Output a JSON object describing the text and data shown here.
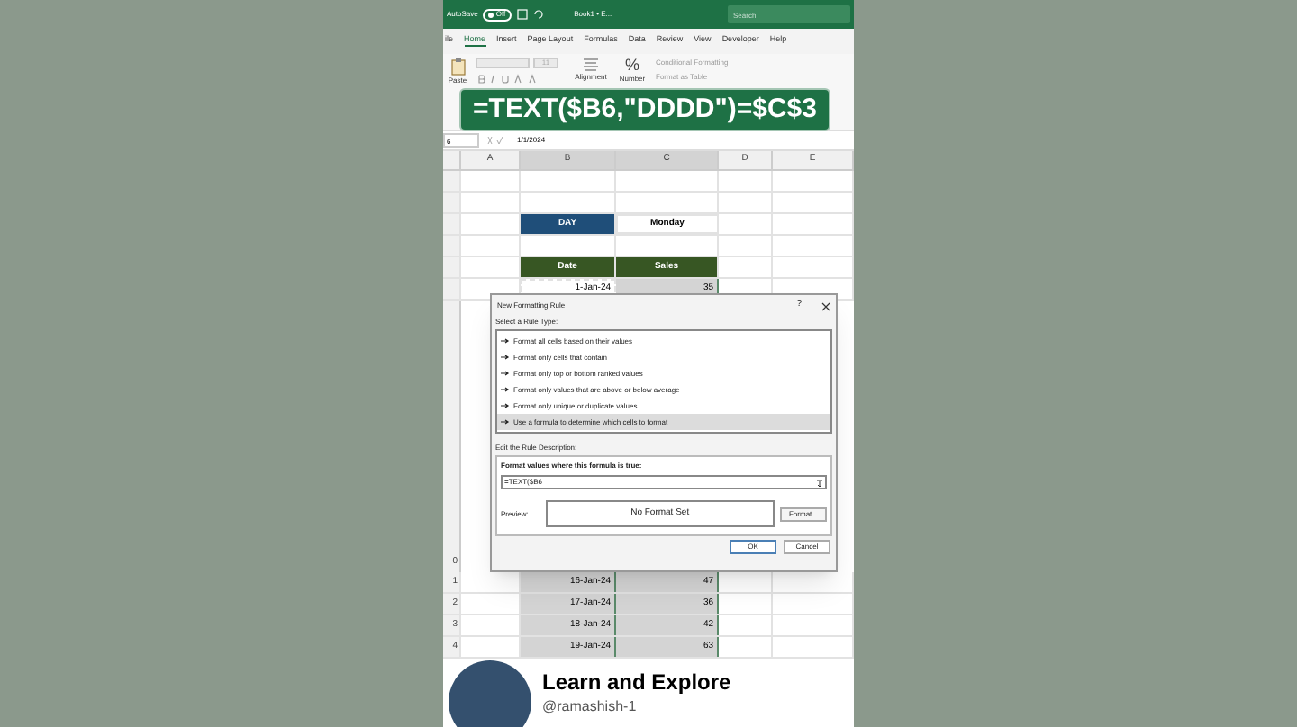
{
  "title_bar": {
    "autosave": "AutoSave",
    "autosave_on": false,
    "toggle_label": "Off",
    "document": "Book1 • E...",
    "search_placeholder": "Search"
  },
  "ribbon_tabs": [
    {
      "label": "ile",
      "selected": false
    },
    {
      "label": "Home",
      "selected": true
    },
    {
      "label": "Insert",
      "selected": false
    },
    {
      "label": "Page Layout",
      "selected": false
    },
    {
      "label": "Formulas",
      "selected": false
    },
    {
      "label": "Data",
      "selected": false
    },
    {
      "label": "Review",
      "selected": false
    },
    {
      "label": "View",
      "selected": false
    },
    {
      "label": "Developer",
      "selected": false
    },
    {
      "label": "Help",
      "selected": false
    }
  ],
  "ribbon": {
    "paste": "Paste",
    "font_size": "11",
    "alignment": "Alignment",
    "number": "Number",
    "number_icon": "%",
    "conditional_formatting": "Conditional Formatting",
    "format_as_table": "Format as Table"
  },
  "formula_banner": "=TEXT($B6,\"DDDD\")=$C$3",
  "formula_bar": {
    "name_box": "6",
    "formula": "1/1/2024"
  },
  "columns": [
    "A",
    "B",
    "C",
    "D",
    "E"
  ],
  "rows_top": [
    {
      "kind": "blank"
    },
    {
      "kind": "blank"
    },
    {
      "kind": "day",
      "label": "DAY",
      "value": "Monday"
    },
    {
      "kind": "blank"
    },
    {
      "kind": "header",
      "date": "Date",
      "sales": "Sales"
    },
    {
      "kind": "data",
      "date": "1-Jan-24",
      "sales": "35",
      "active": true
    }
  ],
  "rows_bottom": [
    {
      "kind": "data",
      "number": "1",
      "date": "16-Jan-24",
      "sales": "47",
      "active": false
    },
    {
      "kind": "data",
      "number": "2",
      "date": "17-Jan-24",
      "sales": "36",
      "active": false
    },
    {
      "kind": "data",
      "number": "3",
      "date": "18-Jan-24",
      "sales": "42",
      "active": false
    },
    {
      "kind": "data",
      "number": "4",
      "date": "19-Jan-24",
      "sales": "63",
      "active": false
    }
  ],
  "hidden_row_number": "0",
  "dialog": {
    "title": "New Formatting Rule",
    "help": "?",
    "select_label": "Select a Rule Type:",
    "rule_types": [
      {
        "label": "Format all cells based on their values",
        "selected": false
      },
      {
        "label": "Format only cells that contain",
        "selected": false
      },
      {
        "label": "Format only top or bottom ranked values",
        "selected": false
      },
      {
        "label": "Format only values that are above or below average",
        "selected": false
      },
      {
        "label": "Format only unique or duplicate values",
        "selected": false
      },
      {
        "label": "Use a formula to determine which cells to format",
        "selected": true
      }
    ],
    "edit_label": "Edit the Rule Description:",
    "formula_label": "Format values where this formula is true:",
    "formula_value": "=TEXT($B6",
    "preview_label": "Preview:",
    "preview_text": "No Format Set",
    "format_button": "Format...",
    "ok": "OK",
    "cancel": "Cancel"
  },
  "channel": {
    "name": "Learn and Explore",
    "handle": "@ramashish-1"
  }
}
